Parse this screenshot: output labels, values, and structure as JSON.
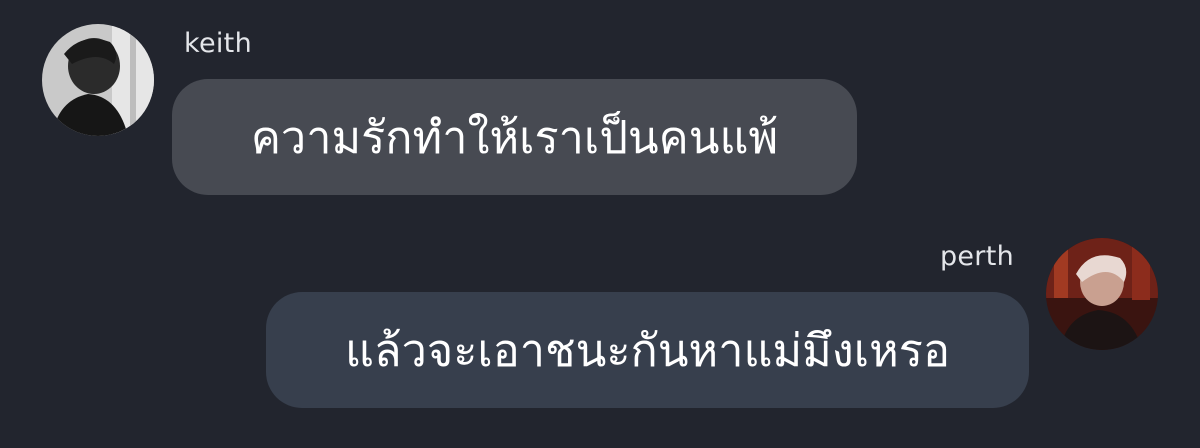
{
  "colors": {
    "background": "#22252e",
    "bubble_incoming": "#474a52",
    "bubble_outgoing": "#373f4d",
    "name_text": "#e4e6ea",
    "message_text": "#ffffff"
  },
  "messages": [
    {
      "sender": "keith",
      "text": "ความรักทำให้เราเป็นคนแพ้",
      "avatar_icon": "user-avatar-keith-photo",
      "side": "left"
    },
    {
      "sender": "perth",
      "text": "แล้วจะเอาชนะกันหาแม่มึงเหรอ",
      "avatar_icon": "user-avatar-perth-photo",
      "side": "right"
    }
  ]
}
